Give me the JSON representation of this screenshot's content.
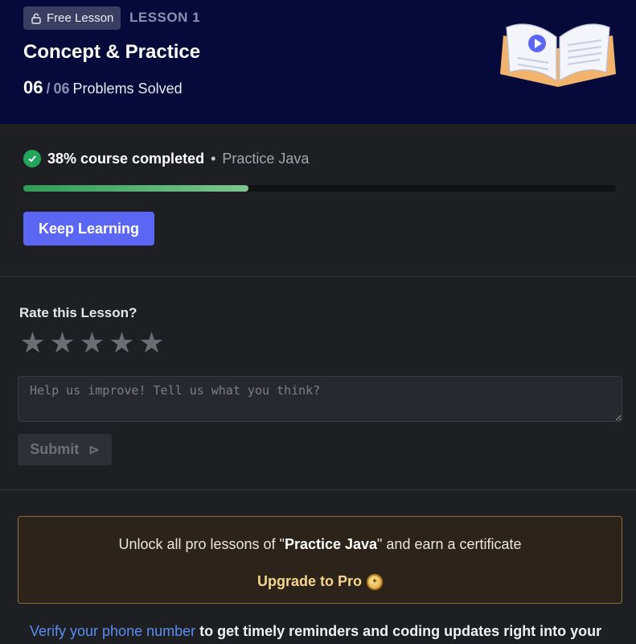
{
  "header": {
    "badge_label": "Free Lesson",
    "lesson_tag": "LESSON 1",
    "title": "Concept & Practice",
    "solved_count": "06",
    "solved_sep": "/",
    "solved_total": "06",
    "solved_label": "Problems Solved"
  },
  "progress": {
    "completed_text": "38% course completed",
    "dot": "•",
    "course_name": "Practice Java",
    "percent": 38,
    "keep_learning_label": "Keep Learning"
  },
  "rating": {
    "title": "Rate this Lesson?",
    "stars": [
      "★",
      "★",
      "★",
      "★",
      "★"
    ],
    "feedback_placeholder": "Help us improve! Tell us what you think?",
    "submit_label": "Submit",
    "submit_icon": "⊳"
  },
  "pro_banner": {
    "text_before": "Unlock all pro lessons of \"",
    "course": "Practice Java",
    "text_after": "\" and earn a certificate",
    "upgrade_label": "Upgrade to Pro"
  },
  "footer": {
    "verify_link": "Verify your phone number",
    "verify_text": " to get timely reminders and coding updates right into your"
  },
  "colors": {
    "header_bg": "#050a3a",
    "accent_button": "#5b66f5",
    "progress_green": "#2f9d57",
    "pro_gold": "#f5d58a",
    "link_blue": "#5a8df2"
  }
}
